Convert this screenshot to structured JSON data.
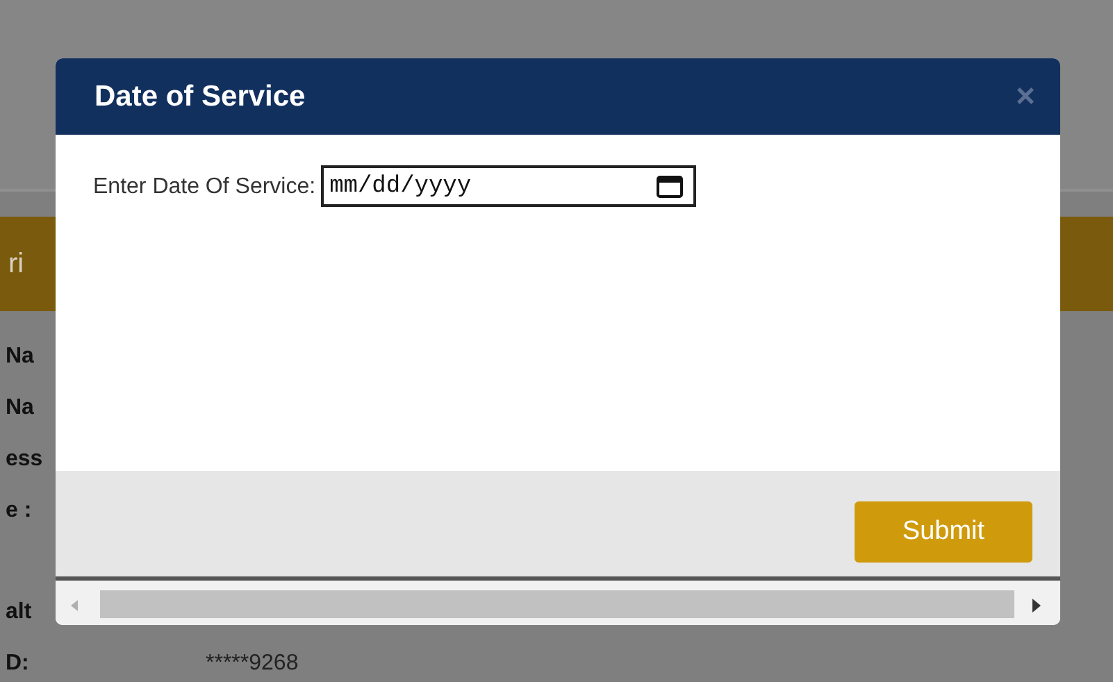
{
  "background": {
    "banner_text": "ri",
    "rows": [
      {
        "label": "Na"
      },
      {
        "label": "Na"
      },
      {
        "label": "ess"
      },
      {
        "label": "e :"
      },
      {
        "label": "alt"
      },
      {
        "label": "D:",
        "value": "*****9268"
      }
    ]
  },
  "dialog": {
    "title": "Date of Service",
    "close": "×",
    "field_label": "Enter Date Of Service:",
    "date_placeholder": "mm/dd/yyyy",
    "submit": "Submit"
  }
}
